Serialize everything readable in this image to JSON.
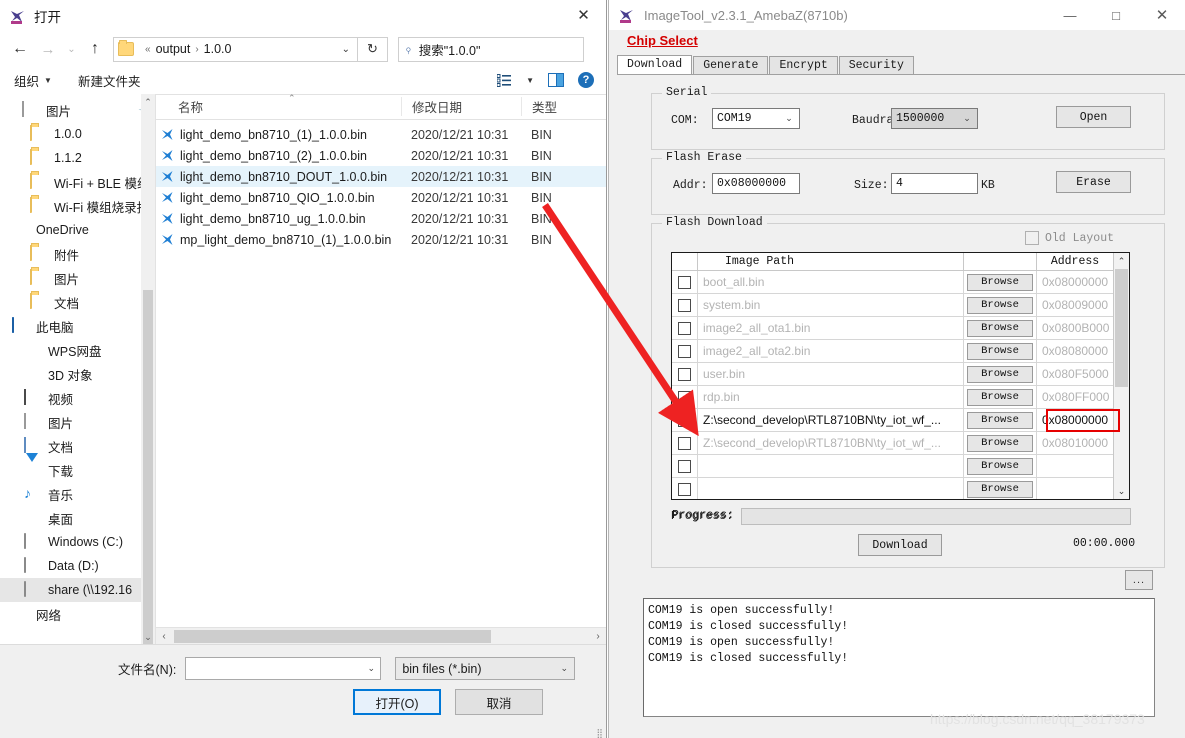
{
  "file_dialog": {
    "title": "打开",
    "close_label": "✕",
    "nav": {
      "back": "←",
      "forward": "→",
      "recent": "⌄",
      "up": "↑",
      "refresh": "↻"
    },
    "breadcrumb": {
      "prefix": "«",
      "parts": [
        "output",
        "1.0.0"
      ],
      "separator": "›",
      "chevron": "⌄"
    },
    "search": {
      "icon": "search-icon",
      "placeholder": "搜索\"1.0.0\"",
      "glyph": "⌕"
    },
    "commandbar": {
      "organize": "组织",
      "organize_chevron": "▼",
      "new_folder": "新建文件夹",
      "help": "?"
    },
    "tree": [
      {
        "label": "图片",
        "icon": "picture-icon",
        "indent": 22,
        "pinned": true,
        "selected": false
      },
      {
        "label": "1.0.0",
        "icon": "folder-icon",
        "indent": 30,
        "pinned": false,
        "selected": false
      },
      {
        "label": "1.1.2",
        "icon": "folder-icon",
        "indent": 30,
        "pinned": false,
        "selected": false
      },
      {
        "label": "Wi-Fi + BLE 模组",
        "icon": "folder-icon",
        "indent": 30,
        "pinned": false,
        "selected": false
      },
      {
        "label": "Wi-Fi 模组烧录指",
        "icon": "folder-icon",
        "indent": 30,
        "pinned": false,
        "selected": false
      },
      {
        "label": "OneDrive",
        "icon": "onedrive-icon",
        "indent": 12,
        "pinned": false,
        "selected": false
      },
      {
        "label": "附件",
        "icon": "folder-icon",
        "indent": 30,
        "pinned": false,
        "selected": false
      },
      {
        "label": "图片",
        "icon": "folder-icon",
        "indent": 30,
        "pinned": false,
        "selected": false
      },
      {
        "label": "文档",
        "icon": "folder-icon",
        "indent": 30,
        "pinned": false,
        "selected": false
      },
      {
        "label": "此电脑",
        "icon": "this-pc-icon",
        "indent": 12,
        "pinned": false,
        "selected": false
      },
      {
        "label": "WPS网盘",
        "icon": "wps-icon",
        "indent": 24,
        "pinned": false,
        "selected": false
      },
      {
        "label": "3D 对象",
        "icon": "3d-objects-icon",
        "indent": 24,
        "pinned": false,
        "selected": false
      },
      {
        "label": "视频",
        "icon": "video-icon",
        "indent": 24,
        "pinned": false,
        "selected": false
      },
      {
        "label": "图片",
        "icon": "picture-icon",
        "indent": 24,
        "pinned": false,
        "selected": false
      },
      {
        "label": "文档",
        "icon": "document-icon",
        "indent": 24,
        "pinned": false,
        "selected": false
      },
      {
        "label": "下载",
        "icon": "download-icon",
        "indent": 24,
        "pinned": false,
        "selected": false
      },
      {
        "label": "音乐",
        "icon": "music-icon",
        "indent": 24,
        "pinned": false,
        "selected": false
      },
      {
        "label": "桌面",
        "icon": "desktop-icon",
        "indent": 24,
        "pinned": false,
        "selected": false
      },
      {
        "label": "Windows (C:)",
        "icon": "windows-drive-icon",
        "indent": 24,
        "pinned": false,
        "selected": false
      },
      {
        "label": "Data (D:)",
        "icon": "drive-icon",
        "indent": 24,
        "pinned": false,
        "selected": false
      },
      {
        "label": "share (\\\\192.16",
        "icon": "network-drive-icon",
        "indent": 24,
        "pinned": false,
        "selected": true
      },
      {
        "label": "网络",
        "icon": "network-icon",
        "indent": 12,
        "pinned": false,
        "selected": false
      }
    ],
    "tree_scroll": {
      "up": "⌃",
      "down": "⌄"
    },
    "columns": [
      "名称",
      "修改日期",
      "类型"
    ],
    "files": [
      {
        "name": "light_demo_bn8710_(1)_1.0.0.bin",
        "date": "2020/12/21 10:31",
        "type": "BIN",
        "selected": false
      },
      {
        "name": "light_demo_bn8710_(2)_1.0.0.bin",
        "date": "2020/12/21 10:31",
        "type": "BIN",
        "selected": false
      },
      {
        "name": "light_demo_bn8710_DOUT_1.0.0.bin",
        "date": "2020/12/21 10:31",
        "type": "BIN",
        "selected": true
      },
      {
        "name": "light_demo_bn8710_QIO_1.0.0.bin",
        "date": "2020/12/21 10:31",
        "type": "BIN",
        "selected": false
      },
      {
        "name": "light_demo_bn8710_ug_1.0.0.bin",
        "date": "2020/12/21 10:31",
        "type": "BIN",
        "selected": false
      },
      {
        "name": "mp_light_demo_bn8710_(1)_1.0.0.bin",
        "date": "2020/12/21 10:31",
        "type": "BIN",
        "selected": false
      }
    ],
    "hscroll": {
      "left": "‹",
      "right": "›"
    },
    "footer": {
      "filename_label": "文件名(N):",
      "filename_value": "",
      "filetype_value": "bin files (*.bin)",
      "open_button": "打开(O)",
      "cancel_button": "取消",
      "chevron": "⌄"
    }
  },
  "image_tool": {
    "title": "ImageTool_v2.3.1_AmebaZ(8710b)",
    "window_buttons": {
      "minimize": "—",
      "maximize": "□",
      "close": "✕"
    },
    "chip_select": "Chip Select",
    "tabs": [
      {
        "label": "Download",
        "active": true
      },
      {
        "label": "Generate",
        "active": false
      },
      {
        "label": "Encrypt",
        "active": false
      },
      {
        "label": "Security",
        "active": false
      }
    ],
    "serial": {
      "caption": "Serial",
      "com_label": "COM:",
      "com_value": "COM19",
      "baudrate_label": "Baudrate:",
      "baudrate_value": "1500000",
      "open_button": "Open",
      "chevron": "⌄"
    },
    "flash_erase": {
      "caption": "Flash Erase",
      "addr_label": "Addr:",
      "addr_value": "0x08000000",
      "size_label": "Size:",
      "size_value": "4",
      "size_unit": "KB",
      "erase_button": "Erase"
    },
    "flash_download": {
      "caption": "Flash Download",
      "old_layout_label": "Old Layout",
      "old_layout_checked": false,
      "columns": [
        "",
        "Image Path",
        "",
        "Address"
      ],
      "browse_label": "Browse",
      "rows": [
        {
          "checked": false,
          "path": "boot_all.bin",
          "address": "0x08000000",
          "active": false
        },
        {
          "checked": false,
          "path": "system.bin",
          "address": "0x08009000",
          "active": false
        },
        {
          "checked": false,
          "path": "image2_all_ota1.bin",
          "address": "0x0800B000",
          "active": false
        },
        {
          "checked": false,
          "path": "image2_all_ota2.bin",
          "address": "0x08080000",
          "active": false
        },
        {
          "checked": false,
          "path": "user.bin",
          "address": "0x080F5000",
          "active": false
        },
        {
          "checked": false,
          "path": "rdp.bin",
          "address": "0x080FF000",
          "active": false
        },
        {
          "checked": true,
          "path": "Z:\\second_develop\\RTL8710BN\\ty_iot_wf_...",
          "address": "0x08000000",
          "active": true
        },
        {
          "checked": false,
          "path": "Z:\\second_develop\\RTL8710BN\\ty_iot_wf_...",
          "address": "0x08010000",
          "active": false
        },
        {
          "checked": false,
          "path": "",
          "address": "",
          "active": false
        },
        {
          "checked": false,
          "path": "",
          "address": "",
          "active": false
        }
      ],
      "scroll": {
        "up": "⌃",
        "down": "⌄"
      },
      "progress_label": "Progress:",
      "progress_percent": 0,
      "download_button": "Download",
      "timer": "00:00.000"
    },
    "more_button": "...",
    "console_lines": [
      "COM19 is open successfully!",
      "COM19 is closed successfully!",
      "COM19 is open successfully!",
      "COM19 is closed successfully!"
    ]
  },
  "annotation": {
    "arrow_color": "#ee2222",
    "highlight_color": "#e60000"
  },
  "watermark": "https://blog.csdn.net/qq_38179373"
}
